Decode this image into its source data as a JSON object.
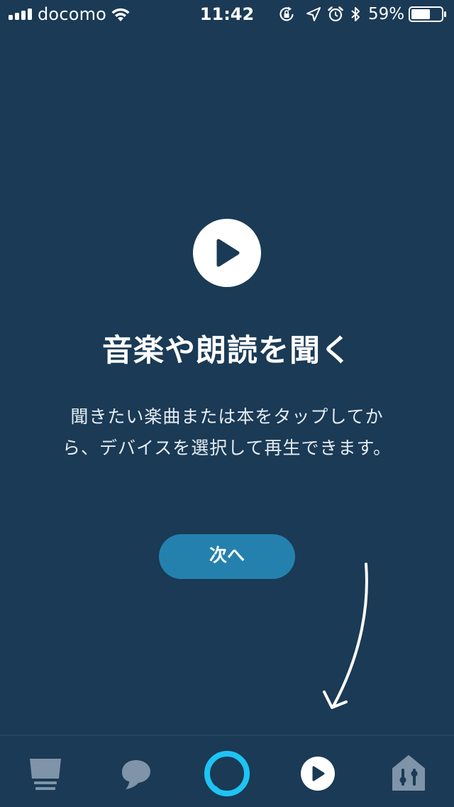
{
  "status_bar": {
    "carrier": "docomo",
    "time": "11:42",
    "battery_percent": "59%",
    "icons": [
      "signal-icon",
      "wifi-icon",
      "rotation-lock-icon",
      "location-icon",
      "alarm-icon",
      "bluetooth-icon",
      "battery-icon"
    ]
  },
  "intro": {
    "icon": "play-icon",
    "title": "音楽や朗読を聞く",
    "description_lines": [
      "聞きたい楽曲または本をタップしてか",
      "ら、デバイスを選択して再生できます。"
    ],
    "next_label": "次へ",
    "hint": "curved-arrow-icon"
  },
  "tab_bar": {
    "tabs": [
      {
        "icon": "home-icon",
        "selected": false
      },
      {
        "icon": "communicate-icon",
        "selected": false
      },
      {
        "icon": "alexa-icon",
        "selected": false
      },
      {
        "icon": "play-icon",
        "selected": true
      },
      {
        "icon": "devices-icon",
        "selected": false
      }
    ]
  },
  "colors": {
    "background": "#1a3a55",
    "button": "#2481ae",
    "alexa_ring": "#1ec4f3",
    "inactive_icon": "#7f94a8",
    "text": "#ffffff"
  }
}
